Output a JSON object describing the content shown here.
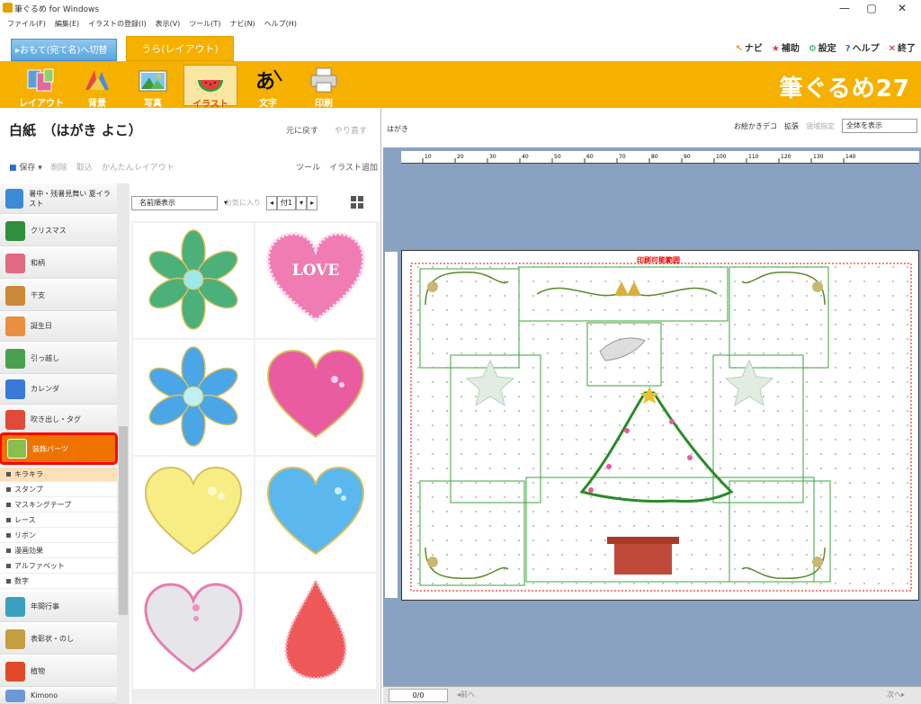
{
  "window": {
    "title": "筆ぐるめ for Windows",
    "min": "—",
    "max": "▢",
    "close": "✕"
  },
  "menu": [
    "ファイル(F)",
    "編集(E)",
    "イラストの登録(I)",
    "表示(V)",
    "ツール(T)",
    "ナビ(N)",
    "ヘルプ(H)"
  ],
  "tabs": {
    "front": "▸おもて(宛て名)へ切替",
    "back": "うら(レイアウト)"
  },
  "toplinks": [
    {
      "icon": "↖",
      "label": "ナビ",
      "color": "#e0a000"
    },
    {
      "icon": "★",
      "label": "補助",
      "color": "#e53a3a"
    },
    {
      "icon": "⚙",
      "label": "設定",
      "color": "#2a9d4a"
    },
    {
      "icon": "?",
      "label": "ヘルプ",
      "color": "#2a6fcf"
    },
    {
      "icon": "✕",
      "label": "終了",
      "color": "#d11"
    }
  ],
  "toolbar": {
    "buttons": [
      "レイアウト",
      "背景",
      "写真",
      "イラスト",
      "文字",
      "印刷"
    ],
    "brand": "筆ぐるめ27"
  },
  "left": {
    "doc_title": "白紙　（はがき よこ）",
    "undo": "元に戻す",
    "redo": "やり直す",
    "actions": [
      "保存",
      "削除",
      "取込",
      "かんたんレイアウト",
      "ツール",
      "イラスト追加"
    ]
  },
  "categories": [
    {
      "label": "暑中・残暑見舞い 夏イラスト",
      "color": "#3d8ad6"
    },
    {
      "label": "クリスマス",
      "color": "#2f8f3f"
    },
    {
      "label": "和柄",
      "color": "#e06a80"
    },
    {
      "label": "干支",
      "color": "#c98a3a"
    },
    {
      "label": "誕生日",
      "color": "#e89040"
    },
    {
      "label": "引っ越し",
      "color": "#4aa050"
    },
    {
      "label": "カレンダ",
      "color": "#3a7ad6"
    },
    {
      "label": "吹き出し・タグ",
      "color": "#e04a3a"
    },
    {
      "label": "装飾パーツ",
      "color": "#88c050"
    }
  ],
  "subcategories": [
    "キラキラ",
    "スタンプ",
    "マスキングテープ",
    "レース",
    "リボン",
    "漫画効果",
    "アルファベット",
    "数字"
  ],
  "categories_bottom": [
    {
      "label": "年間行事",
      "color": "#3aa0c0"
    },
    {
      "label": "表彰状・のし",
      "color": "#c0a040"
    },
    {
      "label": "植物",
      "color": "#e04a2a"
    },
    {
      "label": "Kimono",
      "color": "#6a9ad6"
    }
  ],
  "gallery": {
    "sort": "名前順表示",
    "favorite": "お気に入り",
    "pager": [
      "◂",
      "付1",
      "▾",
      "▸"
    ],
    "items": [
      "green-flower",
      "pink-love-heart",
      "blue-flower",
      "pink-heart",
      "yellow-heart",
      "blue-heart",
      "silver-heart",
      "red-drop"
    ],
    "love_text": "LOVE"
  },
  "right": {
    "label": "はがき",
    "controls": [
      "お絵かきデコ",
      "拡張",
      "領域指定"
    ],
    "zoom": "全体を表示",
    "print_area": "印刷可能範囲",
    "page": "0/0",
    "prev": "◂前へ",
    "next": "次へ▸"
  },
  "ruler_ticks": [
    "10",
    "20",
    "30",
    "40",
    "50",
    "60",
    "70",
    "80",
    "90",
    "100",
    "110",
    "120",
    "130",
    "140"
  ]
}
